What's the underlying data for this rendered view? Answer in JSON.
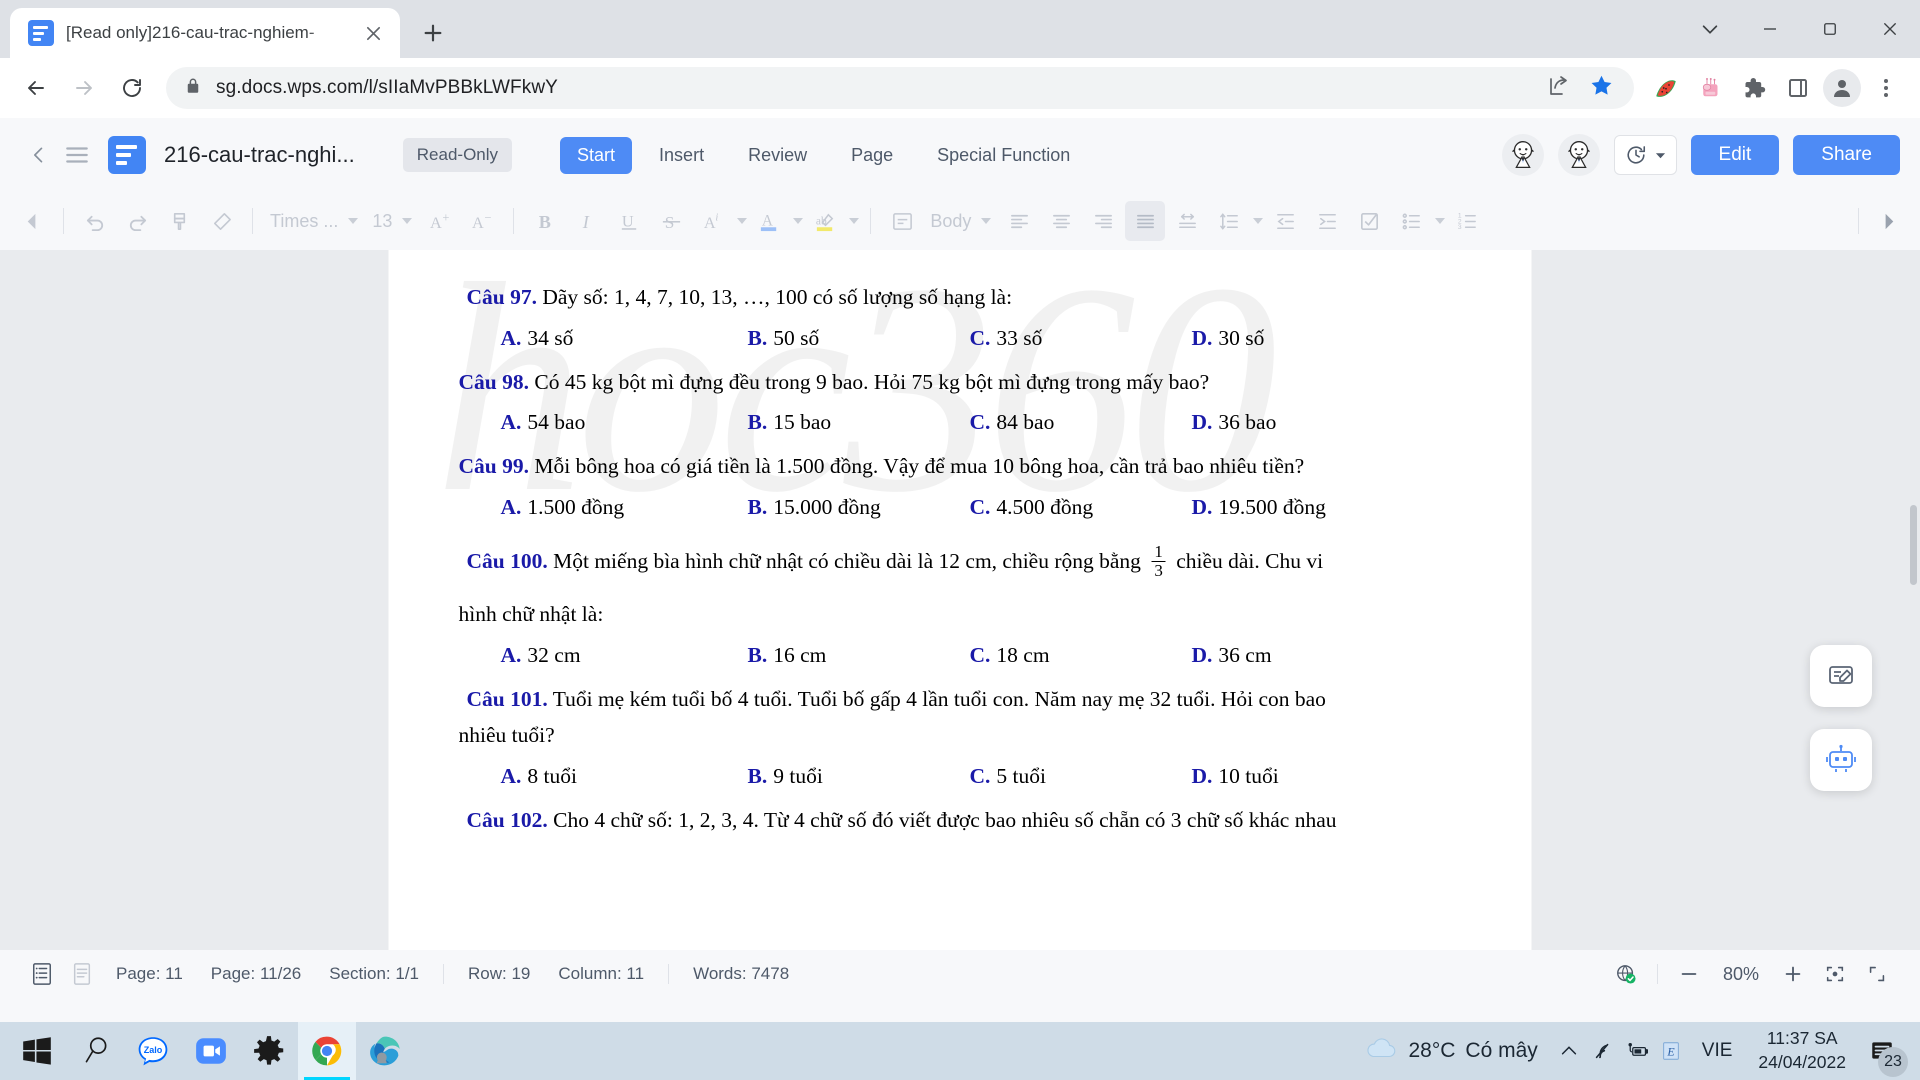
{
  "browser": {
    "tab": {
      "title": "[Read only]216-cau-trac-nghiem-",
      "favicon": "wps-doc-icon",
      "close": "close-icon"
    },
    "new_tab_label": "+",
    "window_controls": [
      "chevron-down-icon",
      "minimize-icon",
      "maximize-icon",
      "close-icon"
    ],
    "nav": {
      "back": "back-arrow-icon",
      "forward": "forward-arrow-icon",
      "reload": "reload-icon"
    },
    "omnibox": {
      "lock": "lock-icon",
      "url": "sg.docs.wps.com/l/sIIaMvPBBkLWFkwY",
      "share": "share-icon",
      "bookmark": "star-icon"
    },
    "extensions": [
      "watermelon-icon",
      "pink-robot-icon",
      "puzzle-piece-icon",
      "side-panel-icon"
    ],
    "profile": "profile-avatar-icon",
    "menu": "three-dot-menu-icon"
  },
  "wps": {
    "back": "chevron-left-icon",
    "menu": "hamburger-menu-icon",
    "logo": "wps-writer-logo",
    "doc_title": "216-cau-trac-nghi...",
    "readonly_badge": "Read-Only",
    "ribbon_tabs": [
      {
        "label": "Start",
        "active": true
      },
      {
        "label": "Insert",
        "active": false
      },
      {
        "label": "Review",
        "active": false
      },
      {
        "label": "Page",
        "active": false
      },
      {
        "label": "Special Function",
        "active": false
      }
    ],
    "collaborators": [
      "user-avatar-1",
      "user-avatar-2"
    ],
    "history_button": "history-clock-icon",
    "edit_label": "Edit",
    "share_label": "Share",
    "format_toolbar": {
      "scroll_left": "chevron-left-icon",
      "scroll_right": "chevron-right-icon",
      "font_name": "Times ...",
      "font_size": "13",
      "paragraph_style": "Body",
      "items": [
        "undo-icon",
        "redo-icon",
        "format-painter-icon",
        "clear-format-icon",
        "increase-font-size-icon",
        "decrease-font-size-icon",
        "bold-icon",
        "italic-icon",
        "underline-icon",
        "strikethrough-icon",
        "text-effects-icon",
        "font-color-icon",
        "highlight-color-icon",
        "align-left-icon",
        "align-center-icon",
        "align-right-icon",
        "align-justify-icon",
        "character-spacing-icon",
        "line-spacing-icon",
        "decrease-indent-icon",
        "increase-indent-icon",
        "checklist-icon",
        "bullet-list-icon",
        "numbered-list-icon"
      ]
    }
  },
  "document": {
    "watermark": "hoc360",
    "questions": [
      {
        "label": "Câu 97.",
        "text": "Dãy số: 1, 4, 7, 10, 13, …, 100 có số lượng số hạng là:",
        "options": [
          {
            "letter": "A.",
            "text": "34 số"
          },
          {
            "letter": "B.",
            "text": "50 số"
          },
          {
            "letter": "C.",
            "text": "33 số"
          },
          {
            "letter": "D.",
            "text": "30 số"
          }
        ]
      },
      {
        "label": "Câu 98.",
        "text": "Có 45 kg bột mì đựng đều trong 9 bao. Hỏi 75 kg bột mì đựng trong mấy bao?",
        "options": [
          {
            "letter": "A.",
            "text": "54 bao"
          },
          {
            "letter": "B.",
            "text": "15 bao"
          },
          {
            "letter": "C.",
            "text": "84 bao"
          },
          {
            "letter": "D.",
            "text": "36 bao"
          }
        ]
      },
      {
        "label": "Câu 99.",
        "text": "Mỗi bông hoa có giá tiền là 1.500 đồng. Vậy để mua 10 bông hoa, cần trả bao nhiêu tiền?",
        "options": [
          {
            "letter": "A.",
            "text": "1.500 đồng"
          },
          {
            "letter": "B.",
            "text": "15.000 đồng"
          },
          {
            "letter": "C.",
            "text": "4.500 đồng"
          },
          {
            "letter": "D.",
            "text": "19.500 đồng"
          }
        ]
      },
      {
        "label": "Câu 100.",
        "text_before_fraction": "Một miếng bìa hình chữ nhật có chiều dài là 12 cm, chiều rộng bằng",
        "fraction_numerator": "1",
        "fraction_denominator": "3",
        "text_after_fraction": "chiều dài. Chu vi",
        "text_line2": "hình chữ nhật là:",
        "options": [
          {
            "letter": "A.",
            "text": "32 cm"
          },
          {
            "letter": "B.",
            "text": "16 cm"
          },
          {
            "letter": "C.",
            "text": "18 cm"
          },
          {
            "letter": "D.",
            "text": "36 cm"
          }
        ]
      },
      {
        "label": "Câu 101.",
        "text": "Tuổi mẹ kém tuổi bố 4 tuổi. Tuổi bố gấp 4 lần tuổi con. Năm nay mẹ 32 tuổi. Hỏi con bao",
        "text_line2": "nhiêu tuổi?",
        "options": [
          {
            "letter": "A.",
            "text": "8 tuổi"
          },
          {
            "letter": "B.",
            "text": "9 tuổi"
          },
          {
            "letter": "C.",
            "text": "5 tuổi"
          },
          {
            "letter": "D.",
            "text": "10 tuổi"
          }
        ]
      },
      {
        "label": "Câu 102.",
        "text": "Cho 4 chữ số: 1, 2, 3, 4. Từ 4 chữ số đó viết được bao nhiêu số chẵn có 3 chữ số khác nhau"
      }
    ],
    "float_buttons": [
      "feedback-pen-icon",
      "robot-assistant-icon"
    ]
  },
  "statusbar": {
    "view_icons": [
      "outline-view-icon",
      "page-view-icon"
    ],
    "page": "Page: 11",
    "page_of": "Page: 11/26",
    "section": "Section: 1/1",
    "row": "Row: 19",
    "column": "Column: 11",
    "words": "Words: 7478",
    "network_status": "network-ok-icon",
    "zoom_out": "minus-icon",
    "zoom": "80%",
    "zoom_in": "plus-icon",
    "fit_page": "fit-page-icon",
    "fullscreen": "fullscreen-icon"
  },
  "taskbar": {
    "start": "windows-start-icon",
    "search": "search-icon",
    "apps": [
      {
        "name": "zalo-icon",
        "label": "Zalo",
        "active": false
      },
      {
        "name": "zoom-icon",
        "label": "",
        "active": false
      },
      {
        "name": "settings-gear-icon",
        "label": "",
        "active": false
      },
      {
        "name": "google-chrome-icon",
        "label": "",
        "active": true
      },
      {
        "name": "microsoft-edge-icon",
        "label": "",
        "active": false
      }
    ],
    "weather": {
      "icon": "cloud-icon",
      "temp": "28°C",
      "desc": "Có mây"
    },
    "tray": [
      "chevron-up-icon",
      "wifi-icon",
      "battery-charging-icon",
      "ime-icon"
    ],
    "language": "VIE",
    "time": "11:37 SA",
    "date": "24/04/2022",
    "notification_icon": "notification-icon",
    "notification_count": "23"
  },
  "colors": {
    "chrome_tabstrip": "#dee1e6",
    "wps_blue": "#4e8bf5",
    "doc_label_blue": "#1a1aa8",
    "taskbar": "#cfdce7"
  }
}
